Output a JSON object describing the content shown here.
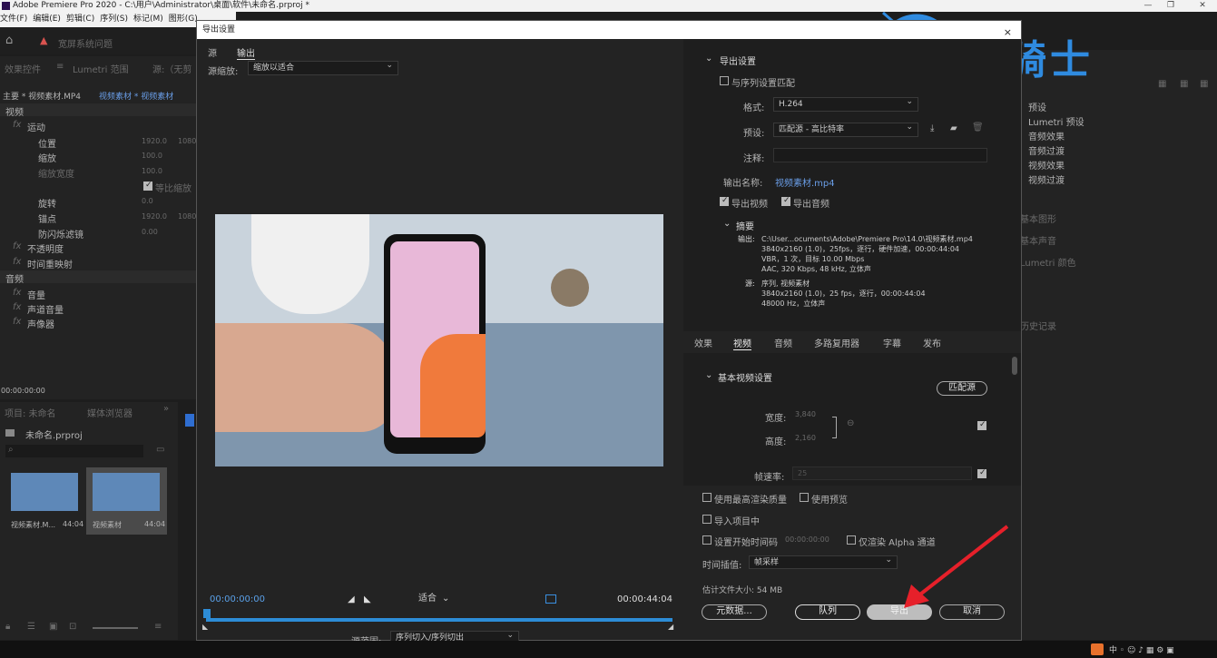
{
  "window": {
    "title": "Adobe Premiere Pro 2020 - C:\\用户\\Administrator\\桌面\\软件\\未命名.prproj *"
  },
  "menu": [
    "文件(F)",
    "编辑(E)",
    "剪辑(C)",
    "序列(S)",
    "标记(M)",
    "图形(G)"
  ],
  "workspace": {
    "warning": "宽屏系统问题"
  },
  "effect_controls": {
    "tabs": [
      "效果控件",
      "Lumetri 范围",
      "源:（无剪"
    ],
    "clip_header": "主要 * 视频素材.MP4",
    "clip_link": "视频素材 * 视频素材",
    "section_video": "视频",
    "motion": "运动",
    "rows": [
      {
        "label": "位置",
        "v1": "1920.0",
        "v2": "1080"
      },
      {
        "label": "缩放",
        "v1": "100.0",
        "v2": ""
      },
      {
        "label": "缩放宽度",
        "v1": "100.0",
        "v2": ""
      },
      {
        "label": "旋转",
        "v1": "0.0",
        "v2": ""
      },
      {
        "label": "锚点",
        "v1": "1920.0",
        "v2": "1080"
      },
      {
        "label": "防闪烁滤镜",
        "v1": "0.00",
        "v2": ""
      }
    ],
    "uniform_scale": "等比缩放",
    "opacity": "不透明度",
    "time_remap": "时间重映射",
    "section_audio": "音频",
    "audio_rows": [
      "音量",
      "声道音量",
      "声像器"
    ],
    "timecode": "00:00:00:00"
  },
  "project": {
    "tabs": [
      "项目: 未命名",
      "媒体浏览器"
    ],
    "file": "未命名.prproj",
    "items": [
      {
        "name": "视频素材.M...",
        "dur": "44:04"
      },
      {
        "name": "视频素材",
        "dur": "44:04"
      }
    ]
  },
  "right_panel": {
    "items": [
      "预设",
      "Lumetri 预设",
      "音频效果",
      "音频过渡",
      "视频效果",
      "视频过渡"
    ],
    "faded": [
      "基本图形",
      "基本声音",
      "Lumetri 颜色",
      "历史记录"
    ]
  },
  "dialog": {
    "title": "导出设置",
    "close": "×",
    "preview_tabs": [
      "源",
      "输出"
    ],
    "source_scale_label": "源缩放:",
    "source_scale_value": "缩放以适合",
    "tc_in": "00:00:00:00",
    "tc_out": "00:00:44:04",
    "fit": "适合",
    "source_range_label": "源范围:",
    "source_range_value": "序列切入/序列切出",
    "export_settings": {
      "header": "导出设置",
      "match_sequence": "与序列设置匹配",
      "format_label": "格式:",
      "format_value": "H.264",
      "preset_label": "预设:",
      "preset_value": "匹配源 - 高比特率",
      "comment_label": "注释:",
      "output_name_label": "输出名称:",
      "output_name_value": "视频素材.mp4",
      "export_video": "导出视频",
      "export_audio": "导出音频",
      "summary_header": "摘要",
      "output_label": "输出:",
      "output_lines": [
        "C:\\User...ocuments\\Adobe\\Premiere Pro\\14.0\\视频素材.mp4",
        "3840x2160 (1.0)，25fps，逐行，硬件加速，00:00:44:04",
        "VBR，1 次，目标 10.00 Mbps",
        "AAC, 320 Kbps, 48  kHz, 立体声"
      ],
      "source_label": "源:",
      "source_lines": [
        "序列, 视频素材",
        "3840x2160 (1.0)，25 fps，逐行，00:00:44:04",
        "48000 Hz，立体声"
      ]
    },
    "settings_tabs": [
      "效果",
      "视频",
      "音频",
      "多路复用器",
      "字幕",
      "发布"
    ],
    "basic_video": {
      "header": "基本视频设置",
      "match_source": "匹配源",
      "width_label": "宽度:",
      "width_value": "3,840",
      "height_label": "高度:",
      "height_value": "2,160",
      "fps_label": "帧速率:",
      "fps_value": "25"
    },
    "bottom": {
      "max_quality": "使用最高渲染质量",
      "use_preview": "使用预览",
      "import_project": "导入项目中",
      "set_start_tc": "设置开始时间码",
      "start_tc_value": "00:00:00:00",
      "alpha_only": "仅渲染 Alpha 通道",
      "interp_label": "时间插值:",
      "interp_value": "帧采样",
      "file_size": "估计文件大小: 54 MB",
      "metadata_btn": "元数据...",
      "queue_btn": "队列",
      "export_btn": "导出",
      "cancel_btn": "取消"
    }
  },
  "watermark": {
    "text": "云骑士"
  },
  "colors": {
    "accent_blue": "#2f8be0",
    "progress_blue": "#2d8cd6",
    "arrow_red": "#e6202a"
  }
}
